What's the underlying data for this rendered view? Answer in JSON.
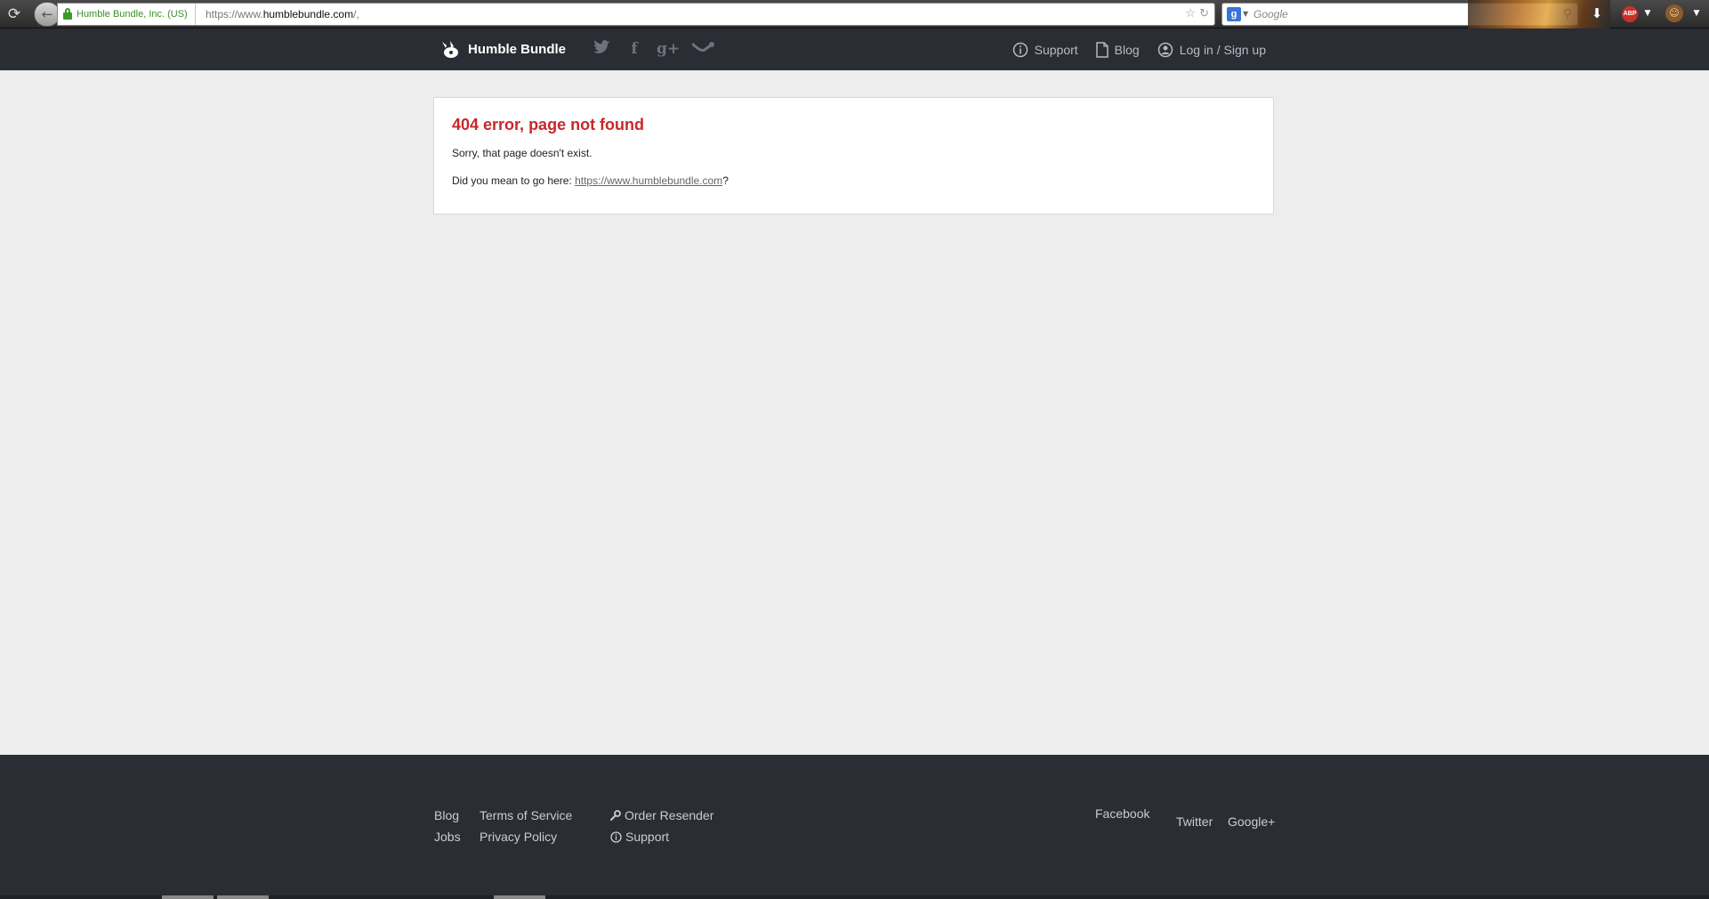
{
  "browser": {
    "identity": "Humble Bundle, Inc. (US)",
    "url_prefix": "https://www.",
    "url_domain": "humblebundle.com",
    "url_suffix": "/,",
    "search_placeholder": "Google"
  },
  "header": {
    "brand": "Humble Bundle",
    "nav": {
      "support": "Support",
      "blog": "Blog",
      "login": "Log in / Sign up"
    }
  },
  "error": {
    "title": "404 error, page not found",
    "message": "Sorry, that page doesn't exist.",
    "suggestion_prefix": "Did you mean to go here: ",
    "suggestion_link": "https://www.humblebundle.com",
    "suggestion_suffix": "?"
  },
  "footer": {
    "col1": [
      "Blog",
      "Jobs"
    ],
    "col2": [
      "Terms of Service",
      "Privacy Policy"
    ],
    "col3": [
      "Order Resender",
      "Support"
    ],
    "social": [
      "Facebook",
      "Twitter",
      "Google+"
    ]
  }
}
